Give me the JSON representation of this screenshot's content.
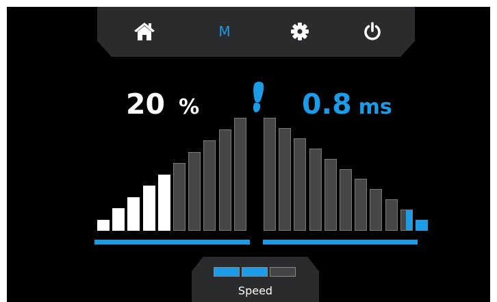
{
  "nav": {
    "items": [
      {
        "name": "home",
        "icon": "home-icon"
      },
      {
        "name": "mode",
        "label": "M"
      },
      {
        "name": "settings",
        "icon": "gear-icon"
      },
      {
        "name": "power",
        "icon": "power-icon"
      }
    ],
    "active": "mode"
  },
  "readouts": {
    "percent_value": "20",
    "percent_unit": "%",
    "speed_value": "0.8",
    "speed_unit": "ms",
    "footprint_icon": "footprint-icon"
  },
  "left_level": {
    "bars_total": 10,
    "bars_active": 5
  },
  "right_level": {
    "bars_total": 11,
    "bars_active_fraction": 0.1
  },
  "speed_selector": {
    "label": "Speed",
    "segments_total": 3,
    "segments_active": 2
  },
  "colors": {
    "accent": "#1c9be6",
    "active_bar": "#ffffff",
    "inactive_bar": "#464646",
    "panel": "#2a2b2d",
    "background": "#000000"
  }
}
